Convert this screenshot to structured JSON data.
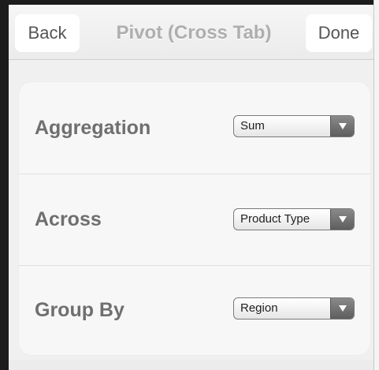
{
  "navbar": {
    "back_label": "Back",
    "title": "Pivot (Cross Tab)",
    "done_label": "Done"
  },
  "settings": {
    "rows": [
      {
        "label": "Aggregation",
        "value": "Sum"
      },
      {
        "label": "Across",
        "value": "Product Type"
      },
      {
        "label": "Group By",
        "value": "Region"
      }
    ]
  },
  "icons": {
    "dropdown": "chevron-down-icon"
  }
}
